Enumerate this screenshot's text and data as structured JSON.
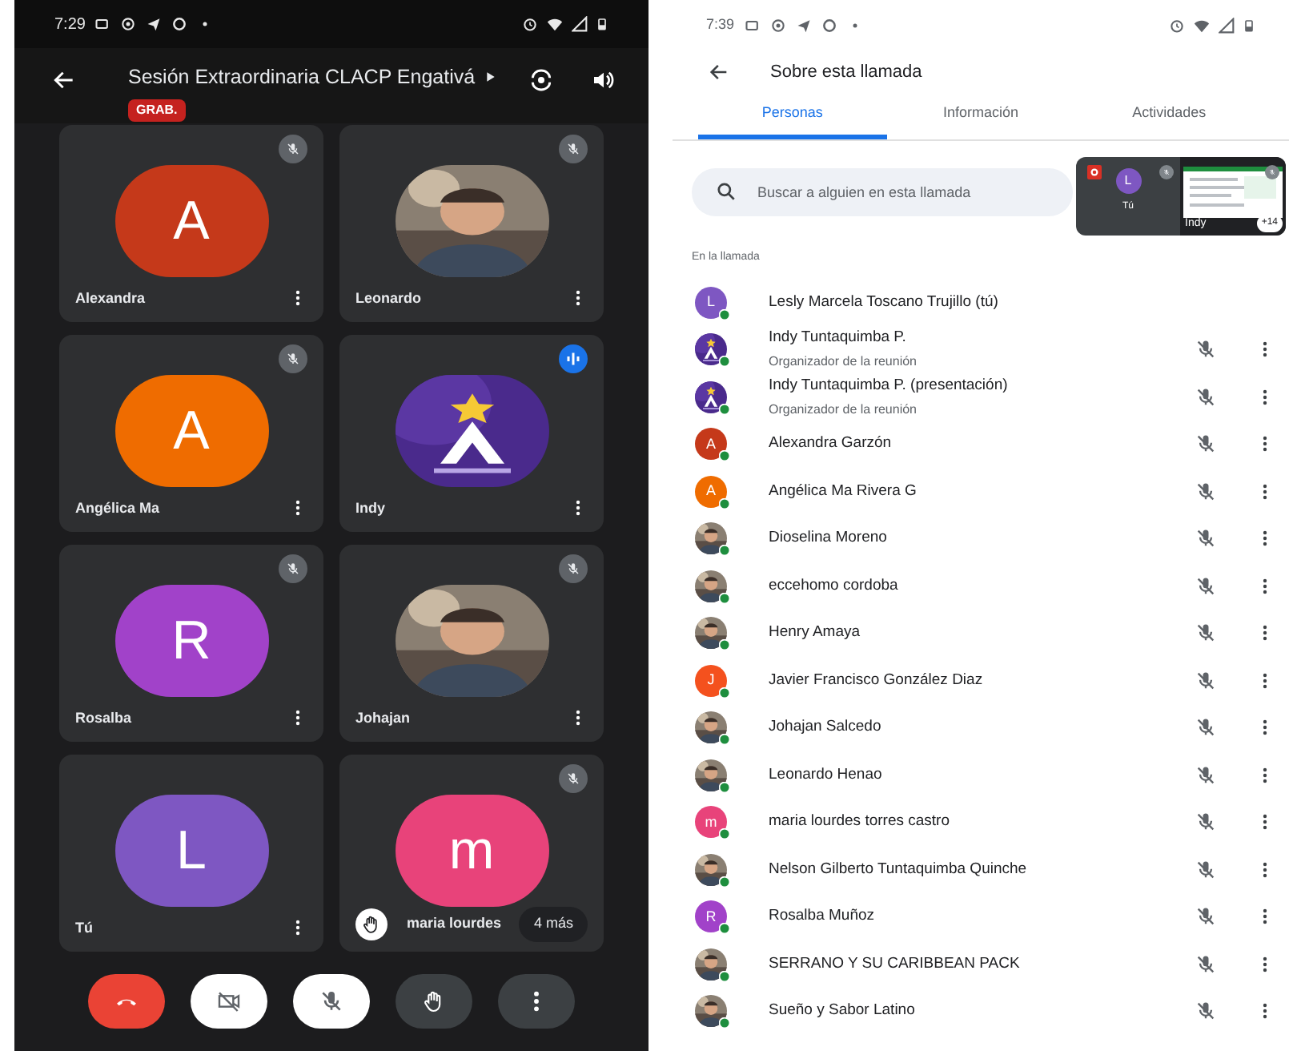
{
  "call_screen": {
    "status_bar": {
      "time": "7:29"
    },
    "header": {
      "title": "Sesión Extraordinaria CLACP Engativá",
      "badge": "GRAB."
    },
    "tiles": [
      {
        "name": "Alexandra",
        "kind": "letter",
        "letter": "A",
        "color": "#c5391a",
        "muted": true,
        "speaking": false,
        "hand_raised": false
      },
      {
        "name": "Leonardo",
        "kind": "picture",
        "muted": true,
        "speaking": false,
        "hand_raised": false
      },
      {
        "name": "Angélica Ma",
        "kind": "letter",
        "letter": "A",
        "color": "#ef6c00",
        "muted": true,
        "speaking": false,
        "hand_raised": false
      },
      {
        "name": "Indy",
        "kind": "logo",
        "muted": false,
        "speaking": true,
        "hand_raised": false
      },
      {
        "name": "Rosalba",
        "kind": "letter",
        "letter": "R",
        "color": "#a142c9",
        "muted": true,
        "speaking": false,
        "hand_raised": false
      },
      {
        "name": "Johajan",
        "kind": "picture",
        "muted": true,
        "speaking": false,
        "hand_raised": false
      },
      {
        "name": "Tú",
        "kind": "letter",
        "letter": "L",
        "color": "#7e57c2",
        "muted": false,
        "speaking": false,
        "hand_raised": false
      },
      {
        "name": "maria lourdes",
        "kind": "letter",
        "letter": "m",
        "color": "#e8437a",
        "muted": true,
        "speaking": false,
        "hand_raised": true,
        "more": "4 más"
      }
    ],
    "controls": [
      {
        "kind": "end-call"
      },
      {
        "kind": "camera-off"
      },
      {
        "kind": "mic-off"
      },
      {
        "kind": "hand"
      },
      {
        "kind": "more"
      }
    ]
  },
  "details_screen": {
    "status_bar": {
      "time": "7:39"
    },
    "title": "Sobre esta llamada",
    "tabs": [
      {
        "label": "Personas",
        "selected": true
      },
      {
        "label": "Información",
        "selected": false
      },
      {
        "label": "Actividades",
        "selected": false
      }
    ],
    "search": {
      "placeholder": "Buscar a alguien en esta llamada"
    },
    "pip": {
      "self_label": "Tú",
      "self_letter": "L",
      "presenter": "Indy",
      "more": "+14"
    },
    "section": "En la llamada",
    "participants": [
      {
        "name": "Lesly Marcela Toscano Trujillo (tú)",
        "kind": "letter",
        "letter": "L",
        "color": "#7e57c2",
        "self": true
      },
      {
        "name": "Indy Tuntaquimba P.",
        "role": "Organizador de la reunión",
        "kind": "logo",
        "self": false
      },
      {
        "name": "Indy Tuntaquimba P. (presentación)",
        "role": "Organizador de la reunión",
        "kind": "logo",
        "self": false
      },
      {
        "name": "Alexandra Garzón",
        "kind": "letter",
        "letter": "A",
        "color": "#c5391a",
        "self": false
      },
      {
        "name": "Angélica Ma Rivera G",
        "kind": "letter",
        "letter": "A",
        "color": "#ef6c00",
        "self": false
      },
      {
        "name": "Dioselina Moreno",
        "kind": "picture",
        "self": false
      },
      {
        "name": "eccehomo cordoba",
        "kind": "picture",
        "self": false
      },
      {
        "name": "Henry Amaya",
        "kind": "picture",
        "self": false
      },
      {
        "name": "Javier Francisco González Diaz",
        "kind": "letter",
        "letter": "J",
        "color": "#f4511e",
        "self": false
      },
      {
        "name": "Johajan Salcedo",
        "kind": "picture",
        "self": false
      },
      {
        "name": "Leonardo Henao",
        "kind": "picture",
        "self": false
      },
      {
        "name": "maria lourdes torres castro",
        "kind": "letter",
        "letter": "m",
        "color": "#e8437a",
        "self": false
      },
      {
        "name": "Nelson Gilberto Tuntaquimba Quinche",
        "kind": "picture",
        "self": false
      },
      {
        "name": "Rosalba Muñoz",
        "kind": "letter",
        "letter": "R",
        "color": "#a142c9",
        "self": false
      },
      {
        "name": "SERRANO Y SU CARIBBEAN PACK",
        "kind": "picture",
        "self": false
      },
      {
        "name": "Sueño y Sabor Latino",
        "kind": "picture",
        "self": false
      }
    ]
  }
}
